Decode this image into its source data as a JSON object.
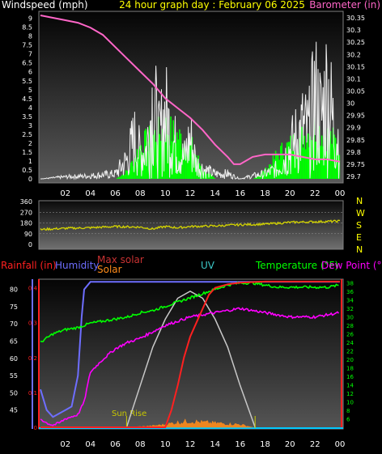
{
  "header": {
    "left_title": "Windspeed (mph)",
    "center_title": "24 hour graph day : February 06 2025",
    "right_title": "Barometer (in)"
  },
  "colors": {
    "windspeed": "#f0f0f0",
    "gust_fill": "#00ff00",
    "barometer": "#ff66c8",
    "winddir": "#d4d400",
    "rainfall": "#ff2020",
    "humidity": "#6e6eff",
    "max_solar": "#c8c8c8",
    "solar": "#ff8c1a",
    "uv": "#3cc8c8",
    "temperature": "#00ff00",
    "dew_point": "#ff00ff",
    "axis_text": "#ffffff",
    "frame": "#00c8ff"
  },
  "chart_data": [
    {
      "type": "line",
      "x_ticks": [
        "02",
        "04",
        "06",
        "08",
        "10",
        "12",
        "14",
        "16",
        "18",
        "20",
        "22",
        "00"
      ],
      "left_axis": {
        "label": "Windspeed (mph)",
        "ticks": [
          "0",
          "0.5",
          "1",
          "1.5",
          "2",
          "2.5",
          "3",
          "3.5",
          "4",
          "4.5",
          "5",
          "5.5",
          "6",
          "6.5",
          "7",
          "7.5",
          "8",
          "8.5",
          "9"
        ],
        "ylim": [
          0,
          9.3
        ]
      },
      "right_axis": {
        "label": "Barometer (in)",
        "ticks": [
          "29.7",
          "29.75",
          "29.8",
          "29.85",
          "29.9",
          "29.95",
          "30",
          "30.05",
          "30.1",
          "30.15",
          "30.2",
          "30.25",
          "30.3",
          "30.35"
        ],
        "ylim": [
          29.69,
          30.37
        ]
      },
      "series": [
        {
          "name": "Windspeed (mph)",
          "x": [
            0,
            2,
            4,
            6,
            7,
            7.5,
            8,
            8.5,
            9,
            9.5,
            10,
            10.5,
            11,
            11.5,
            12,
            12.5,
            13,
            14,
            15,
            16,
            17,
            18,
            19,
            20,
            20.5,
            21,
            21.5,
            22,
            22.5,
            23,
            23.5,
            24
          ],
          "values": [
            0,
            0.2,
            0.3,
            0.5,
            2,
            4,
            2.5,
            3,
            8,
            4,
            6.5,
            4,
            3,
            2,
            4,
            1.5,
            1,
            0.5,
            0.5,
            0,
            0.3,
            0.5,
            1,
            3,
            4,
            5,
            4.5,
            8,
            6,
            9,
            5,
            4
          ]
        },
        {
          "name": "Gust",
          "x": [
            0,
            2,
            4,
            6,
            7,
            8,
            9,
            10,
            11,
            12,
            13,
            14,
            15,
            16,
            17,
            18,
            19,
            20,
            21,
            22,
            23,
            24
          ],
          "values": [
            0,
            0,
            0,
            0,
            0.5,
            2,
            2.5,
            3,
            2.5,
            2,
            0.5,
            0,
            0,
            0,
            0,
            0.5,
            1.5,
            2,
            2.5,
            3,
            2.5,
            2
          ]
        },
        {
          "name": "Barometer (in)",
          "x": [
            0,
            1,
            2,
            3,
            4,
            5,
            6,
            7,
            8,
            9,
            10,
            11,
            12,
            13,
            14,
            15,
            15.5,
            16,
            17,
            18,
            19,
            20,
            21,
            22,
            23,
            24
          ],
          "values": [
            30.36,
            30.35,
            30.34,
            30.33,
            30.31,
            30.28,
            30.23,
            30.18,
            30.13,
            30.08,
            30.02,
            29.98,
            29.94,
            29.89,
            29.83,
            29.78,
            29.75,
            29.75,
            29.78,
            29.79,
            29.79,
            29.79,
            29.78,
            29.77,
            29.77,
            29.76
          ]
        }
      ]
    },
    {
      "type": "line",
      "x_ticks": [
        "02",
        "04",
        "06",
        "08",
        "10",
        "12",
        "14",
        "16",
        "18",
        "20",
        "22",
        "00"
      ],
      "left_axis": {
        "ticks": [
          "360",
          "270",
          "180",
          "90",
          "0"
        ],
        "ylim": [
          0,
          360
        ]
      },
      "compass": [
        "N",
        "W",
        "S",
        "E",
        "N"
      ],
      "series": [
        {
          "name": "Wind direction",
          "x": [
            0,
            2,
            4,
            6,
            8,
            9,
            10,
            11,
            12,
            14,
            16,
            18,
            20,
            22,
            24
          ],
          "values": [
            125,
            135,
            140,
            150,
            145,
            130,
            150,
            140,
            150,
            155,
            165,
            170,
            185,
            190,
            195
          ]
        }
      ]
    },
    {
      "type": "line",
      "x_ticks": [
        "02",
        "04",
        "06",
        "08",
        "10",
        "12",
        "14",
        "16",
        "18",
        "20",
        "22",
        "00"
      ],
      "left_axes": [
        {
          "label": "Rainfall (in)",
          "ticks": [
            "0",
            "0.1",
            "0.2",
            "0.3",
            "0.4"
          ],
          "ylim": [
            0,
            0.42
          ]
        },
        {
          "label": "Humidity",
          "ticks": [
            "45",
            "50",
            "55",
            "60",
            "65",
            "70",
            "75",
            "80"
          ],
          "ylim": [
            40,
            82.5
          ]
        }
      ],
      "right_axis": {
        "label": "Temperature (°F)",
        "ticks": [
          "6",
          "8",
          "10",
          "12",
          "14",
          "16",
          "18",
          "20",
          "22",
          "24",
          "26",
          "28",
          "30",
          "32",
          "34",
          "36",
          "38"
        ],
        "ylim": [
          4,
          38.5
        ]
      },
      "legend": [
        "Max solar",
        "Solar",
        "UV",
        "Temperature (°F)",
        "Dew Point (°F)"
      ],
      "annotations": [
        "Sun Rise"
      ],
      "series": [
        {
          "name": "Humidity",
          "x": [
            0,
            0.5,
            1,
            1.5,
            2,
            2.5,
            3,
            3.3,
            3.5,
            4,
            6,
            8,
            10,
            12,
            14,
            16,
            18,
            20,
            22,
            24
          ],
          "values": [
            51,
            45,
            43,
            44,
            45,
            46,
            55,
            72,
            80,
            82.2,
            82.2,
            82.2,
            82.2,
            82.2,
            82.2,
            82.2,
            82.2,
            82.2,
            82.2,
            82.2
          ]
        },
        {
          "name": "Temperature (°F)",
          "x": [
            0,
            1,
            2,
            3,
            4,
            5,
            6,
            7,
            8,
            9,
            10,
            11,
            12,
            13,
            14,
            15,
            16,
            17,
            18,
            19,
            20,
            21,
            22,
            23,
            24
          ],
          "values": [
            24,
            26,
            27,
            27.5,
            28.5,
            29,
            29.5,
            30,
            31,
            31.5,
            32.5,
            33.5,
            34.5,
            35.5,
            36.5,
            37.5,
            38,
            38,
            37.5,
            37,
            37,
            37,
            37,
            37,
            37.5
          ]
        },
        {
          "name": "Dew Point (°F)",
          "x": [
            0,
            0.5,
            1,
            1.5,
            2,
            2.5,
            3,
            3.5,
            4,
            5,
            6,
            7,
            8,
            9,
            10,
            11,
            12,
            13,
            14,
            15,
            16,
            17,
            18,
            19,
            20,
            21,
            22,
            23,
            24
          ],
          "values": [
            6,
            5,
            4.5,
            5,
            6,
            6.5,
            7,
            10,
            17,
            20,
            22.5,
            24,
            25,
            26.5,
            28,
            29,
            30,
            30.5,
            31,
            31.5,
            32,
            31.5,
            31,
            30.5,
            30,
            30,
            30,
            30.5,
            31
          ]
        },
        {
          "name": "Rainfall (in)",
          "x": [
            0,
            10,
            10.5,
            11,
            11.5,
            12,
            12.5,
            13,
            13.5,
            14,
            15,
            16,
            18,
            20,
            22,
            24
          ],
          "values": [
            0,
            0,
            0.05,
            0.12,
            0.2,
            0.26,
            0.3,
            0.34,
            0.38,
            0.4,
            0.41,
            0.415,
            0.418,
            0.418,
            0.418,
            0.418
          ]
        },
        {
          "name": "Max solar",
          "x": [
            6.9,
            8,
            9,
            10,
            11,
            12,
            13,
            14,
            15,
            16,
            17.2
          ],
          "values": [
            0,
            0.12,
            0.23,
            0.31,
            0.37,
            0.39,
            0.37,
            0.31,
            0.23,
            0.12,
            0
          ]
        },
        {
          "name": "Solar",
          "x": [
            7,
            8,
            9,
            10,
            11,
            12,
            13,
            14,
            15,
            16,
            17
          ],
          "values": [
            0,
            0.002,
            0.004,
            0.008,
            0.014,
            0.018,
            0.014,
            0.012,
            0.01,
            0.008,
            0
          ]
        }
      ]
    }
  ]
}
